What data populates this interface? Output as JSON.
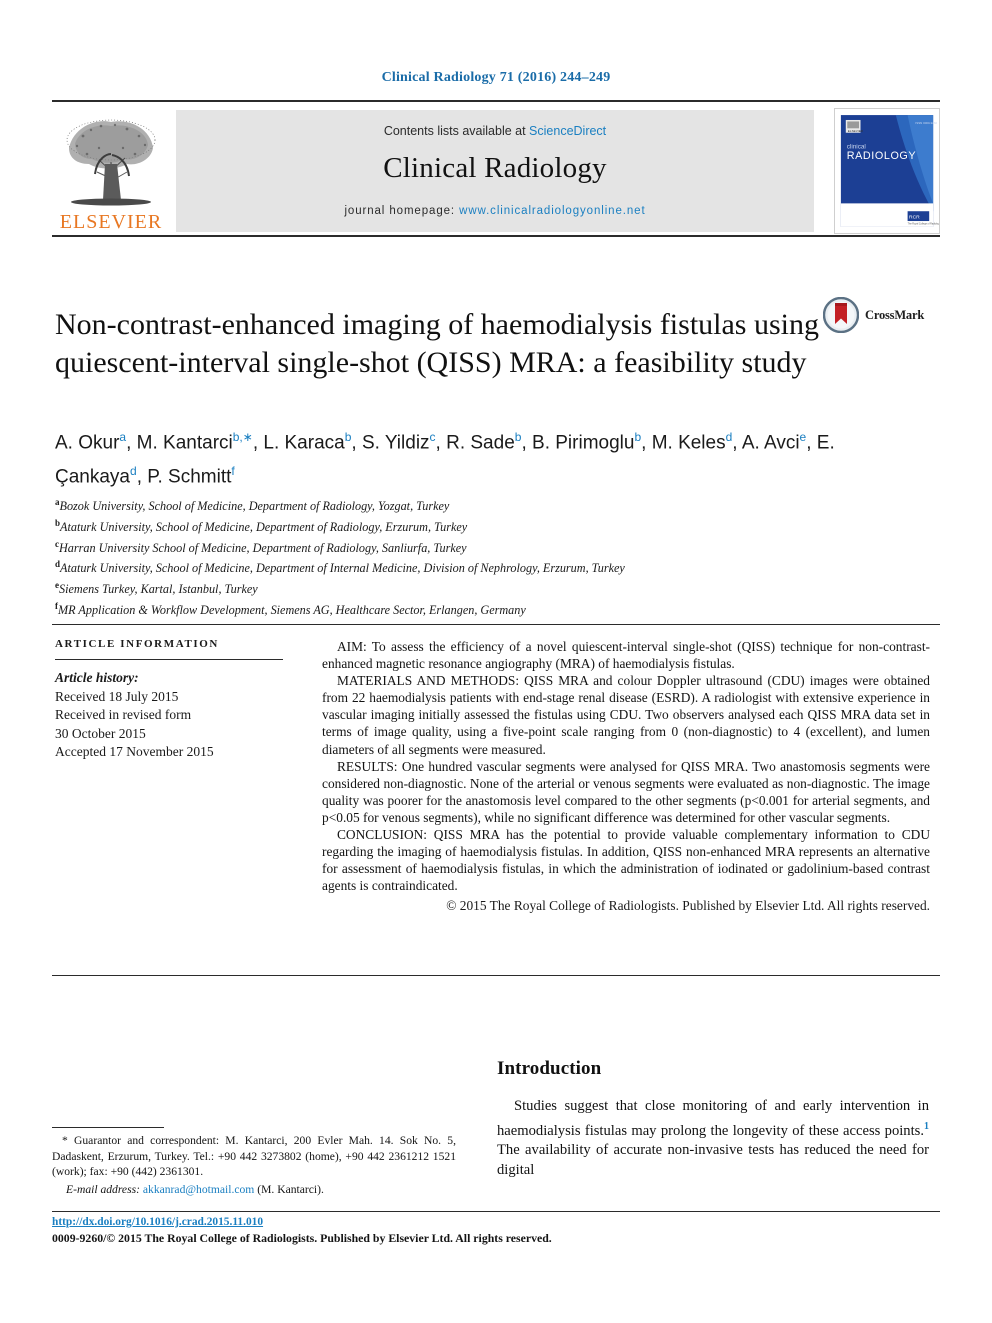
{
  "running_head": "Clinical Radiology 71 (2016) 244–249",
  "masthead": {
    "publisher_logo_text": "ELSEVIER",
    "contents_prefix": "Contents lists available at ",
    "contents_link": "ScienceDirect",
    "journal_name": "Clinical Radiology",
    "homepage_prefix": "journal homepage: ",
    "homepage_url": "www.clinicalradiologyonline.net",
    "cover_title_small": "clinical",
    "cover_title_large": "RADIOLOGY"
  },
  "title": "Non-contrast-enhanced imaging of haemodialysis fistulas using quiescent-interval single-shot (QISS) MRA: a feasibility study",
  "crossmark": {
    "label": "CrossMark"
  },
  "authors": [
    {
      "name": "A. Okur",
      "sup": "a",
      "sep": ", "
    },
    {
      "name": "M. Kantarci",
      "sup": "b,∗",
      "sep": ", "
    },
    {
      "name": "L. Karaca",
      "sup": "b",
      "sep": ", "
    },
    {
      "name": "S. Yildiz",
      "sup": "c",
      "sep": ", "
    },
    {
      "name": "R. Sade",
      "sup": "b",
      "sep": ", "
    },
    {
      "name": "B. Pirimoglu",
      "sup": "b",
      "sep": ", "
    },
    {
      "name": "M. Keles",
      "sup": "d",
      "sep": ", "
    },
    {
      "name": "A. Avci",
      "sup": "e",
      "sep": ", "
    },
    {
      "name": "E. Çankaya",
      "sup": "d",
      "sep": ", "
    },
    {
      "name": "P. Schmitt",
      "sup": "f",
      "sep": ""
    }
  ],
  "affiliations": [
    {
      "marker": "a",
      "text": "Bozok University, School of Medicine, Department of Radiology, Yozgat, Turkey"
    },
    {
      "marker": "b",
      "text": "Ataturk University, School of Medicine, Department of Radiology, Erzurum, Turkey"
    },
    {
      "marker": "c",
      "text": "Harran University School of Medicine, Department of Radiology, Sanliurfa, Turkey"
    },
    {
      "marker": "d",
      "text": "Ataturk University, School of Medicine, Department of Internal Medicine, Division of Nephrology, Erzurum, Turkey"
    },
    {
      "marker": "e",
      "text": "Siemens Turkey, Kartal, Istanbul, Turkey"
    },
    {
      "marker": "f",
      "text": "MR Application & Workflow Development, Siemens AG, Healthcare Sector, Erlangen, Germany"
    }
  ],
  "article_info": {
    "heading": "ARTICLE INFORMATION",
    "history_label": "Article history:",
    "history": [
      "Received 18 July 2015",
      "Received in revised form",
      "30 October 2015",
      "Accepted 17 November 2015"
    ]
  },
  "abstract": {
    "aim": "AIM: To assess the efficiency of a novel quiescent-interval single-shot (QISS) technique for non-contrast-enhanced magnetic resonance angiography (MRA) of haemodialysis fistulas.",
    "materials": "MATERIALS AND METHODS: QISS MRA and colour Doppler ultrasound (CDU) images were obtained from 22 haemodialysis patients with end-stage renal disease (ESRD). A radiologist with extensive experience in vascular imaging initially assessed the fistulas using CDU. Two observers analysed each QISS MRA data set in terms of image quality, using a five-point scale ranging from 0 (non-diagnostic) to 4 (excellent), and lumen diameters of all segments were measured.",
    "results": "RESULTS: One hundred vascular segments were analysed for QISS MRA. Two anastomosis segments were considered non-diagnostic. None of the arterial or venous segments were evaluated as non-diagnostic. The image quality was poorer for the anastomosis level compared to the other segments (p<0.001 for arterial segments, and p<0.05 for venous segments), while no significant difference was determined for other vascular segments.",
    "conclusion": "CONCLUSION: QISS MRA has the potential to provide valuable complementary information to CDU regarding the imaging of haemodialysis fistulas. In addition, QISS non-enhanced MRA represents an alternative for assessment of haemodialysis fistulas, in which the administration of iodinated or gadolinium-based contrast agents is contraindicated.",
    "copyright": "© 2015 The Royal College of Radiologists. Published by Elsevier Ltd. All rights reserved."
  },
  "introduction": {
    "heading": "Introduction",
    "paragraph_part1": "Studies suggest that close monitoring of and early intervention in haemodialysis fistulas may prolong the longevity of these access points.",
    "paragraph_ref": "1",
    "paragraph_part2": " The availability of accurate non-invasive tests has reduced the need for digital"
  },
  "footnotes": {
    "correspondence": "* Guarantor and correspondent: M. Kantarci, 200 Evler Mah. 14. Sok No. 5, Dadaskent, Erzurum, Turkey. Tel.: +90 442 3273802 (home), +90 442 2361212 1521 (work); fax: +90 (442) 2361301.",
    "email_label": "E-mail address:",
    "email": "akkanrad@hotmail.com",
    "email_suffix": " (M. Kantarci)."
  },
  "footer": {
    "doi": "http://dx.doi.org/10.1016/j.crad.2015.11.010",
    "issn_line": "0009-9260/© 2015 The Royal College of Radiologists. Published by Elsevier Ltd. All rights reserved."
  },
  "colors": {
    "link_blue": "#1a7fc1",
    "header_blue": "#1a6ca8",
    "elsevier_orange": "#e87722",
    "masthead_grey": "#e4e4e4",
    "cover_blue": "#1c3f94"
  }
}
